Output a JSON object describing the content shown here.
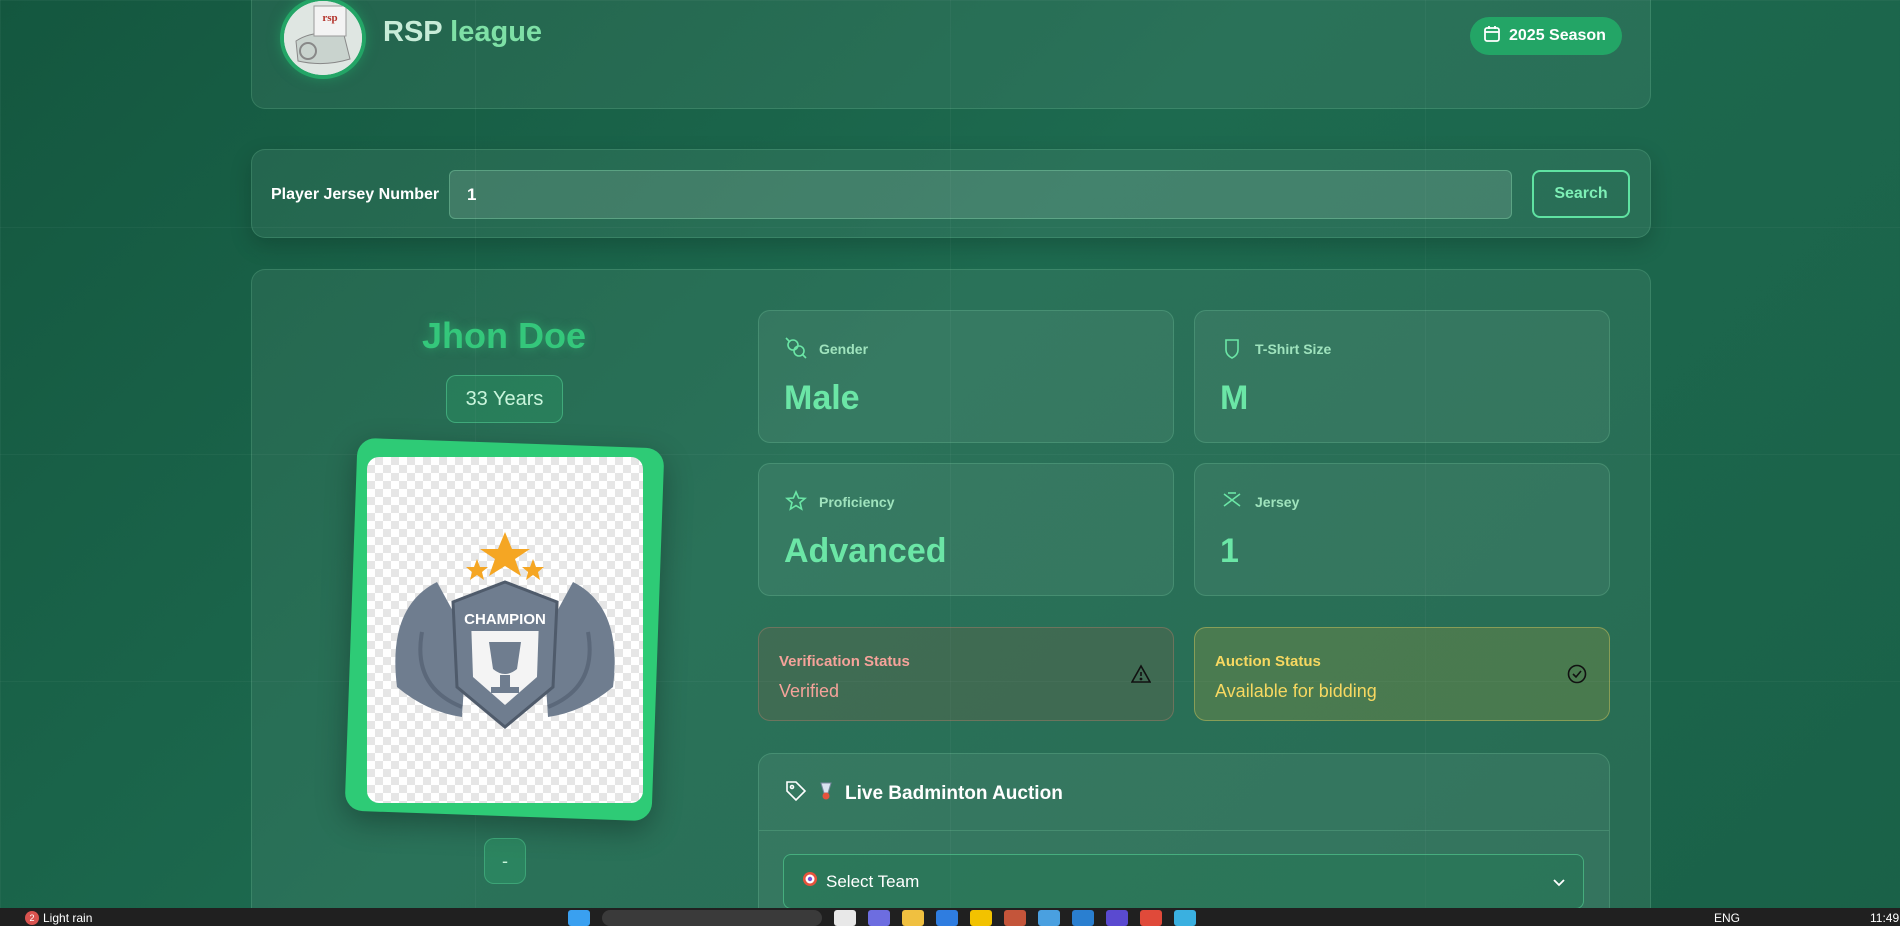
{
  "header": {
    "title_main": "RSP",
    "title_accent": " league",
    "logo_text": "rsp",
    "season": "2025 Season"
  },
  "search": {
    "label": "Player Jersey Number",
    "value": "1",
    "button": "Search"
  },
  "player": {
    "name": "Jhon Doe",
    "age": "33 Years",
    "card_badge": "CHAMPION",
    "action": "-"
  },
  "info": [
    {
      "label": "Gender",
      "value": "Male",
      "icon": "gender-icon"
    },
    {
      "label": "T-Shirt Size",
      "value": "M",
      "icon": "shirt-icon"
    },
    {
      "label": "Proficiency",
      "value": "Advanced",
      "icon": "star-icon"
    },
    {
      "label": "Jersey",
      "value": "1",
      "icon": "jersey-icon"
    }
  ],
  "status": {
    "verification_label": "Verification Status",
    "verification_value": "Verified",
    "auction_label": "Auction Status",
    "auction_value": "Available for bidding"
  },
  "auction": {
    "title": "Live Badminton Auction",
    "select_placeholder": "Select Team"
  },
  "taskbar": {
    "weather_count": "2",
    "weather": "Light rain",
    "lang": "ENG",
    "time": "11:49"
  },
  "colors": {
    "accent": "#23a566",
    "verified": "#f5a39a",
    "auction": "#f7d861"
  }
}
